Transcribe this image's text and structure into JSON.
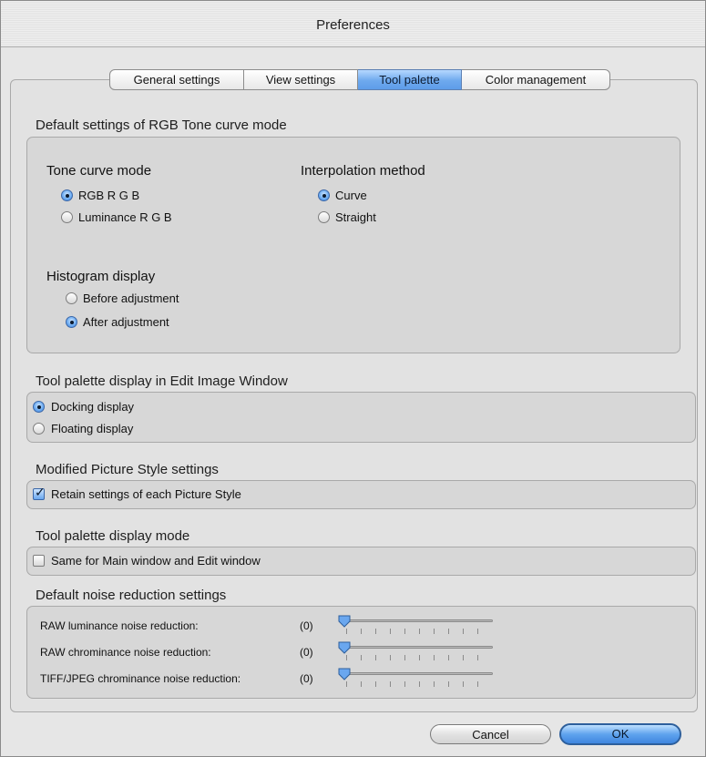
{
  "window": {
    "title": "Preferences"
  },
  "tabs": [
    "General settings",
    "View settings",
    "Tool palette",
    "Color management"
  ],
  "active_tab": "Tool palette",
  "rgb_tone": {
    "section_title": "Default settings of RGB Tone curve mode",
    "tone_curve_mode": {
      "heading": "Tone curve mode",
      "options": [
        "RGB R G B",
        "Luminance R G B"
      ],
      "selected": "RGB R G B"
    },
    "interpolation": {
      "heading": "Interpolation method",
      "options": [
        "Curve",
        "Straight"
      ],
      "selected": "Curve"
    },
    "histogram": {
      "heading": "Histogram display",
      "options": [
        "Before adjustment",
        "After adjustment"
      ],
      "selected": "After adjustment"
    }
  },
  "tool_palette_display": {
    "section_title": "Tool palette display in Edit Image Window",
    "options": [
      "Docking display",
      "Floating display"
    ],
    "selected": "Docking display"
  },
  "picture_style": {
    "section_title": "Modified Picture Style settings",
    "checkbox_label": "Retain settings of each Picture Style",
    "checked": true
  },
  "palette_mode": {
    "section_title": "Tool palette display mode",
    "checkbox_label": "Same for Main window and Edit window",
    "checked": false
  },
  "noise": {
    "section_title": "Default noise reduction settings",
    "rows": [
      {
        "label": "RAW luminance noise reduction:",
        "value": "(0)",
        "level": 0
      },
      {
        "label": "RAW chrominance noise reduction:",
        "value": "(0)",
        "level": 0
      },
      {
        "label": "TIFF/JPEG chrominance noise reduction:",
        "value": "(0)",
        "level": 0
      }
    ]
  },
  "buttons": {
    "cancel": "Cancel",
    "ok": "OK"
  }
}
